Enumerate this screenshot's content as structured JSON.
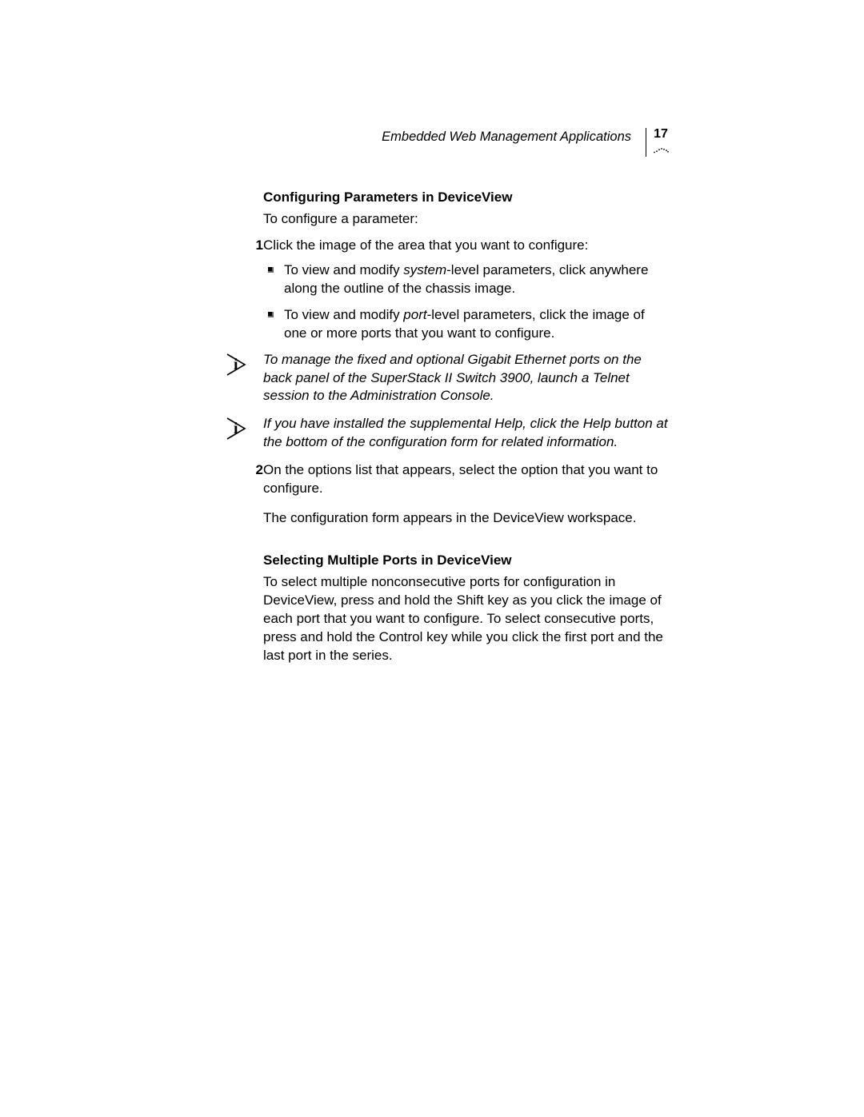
{
  "header": {
    "running_title": "Embedded Web Management Applications",
    "page_number": "17"
  },
  "section1": {
    "heading": "Configuring Parameters in DeviceView",
    "intro": "To configure a parameter:",
    "step1_num": "1",
    "step1_text": "Click the image of the area that you want to configure:",
    "bullet1_pre": "To view and modify ",
    "bullet1_em": "system",
    "bullet1_post": "-level parameters, click anywhere along the outline of the chassis image.",
    "bullet2_pre": "To view and modify ",
    "bullet2_em": "port",
    "bullet2_post": "-level parameters, click the image of one or more ports that you want to configure.",
    "note1": "To manage the fixed and optional Gigabit Ethernet ports on the back panel of the SuperStack II Switch 3900, launch a Telnet session to the Administration Console.",
    "note2": "If you have installed the supplemental Help, click the Help button at the bottom of the configuration form for related information.",
    "step2_num": "2",
    "step2_text": "On the options list that appears, select the option that you want to configure.",
    "step2_follow": "The configuration form appears in the DeviceView workspace."
  },
  "section2": {
    "heading": "Selecting Multiple Ports in DeviceView",
    "body": "To select multiple nonconsecutive ports for configuration in DeviceView, press and hold the Shift key as you click the image of each port that you want to configure. To select consecutive ports, press and hold the Control key while you click the first port and the last port in the series."
  }
}
